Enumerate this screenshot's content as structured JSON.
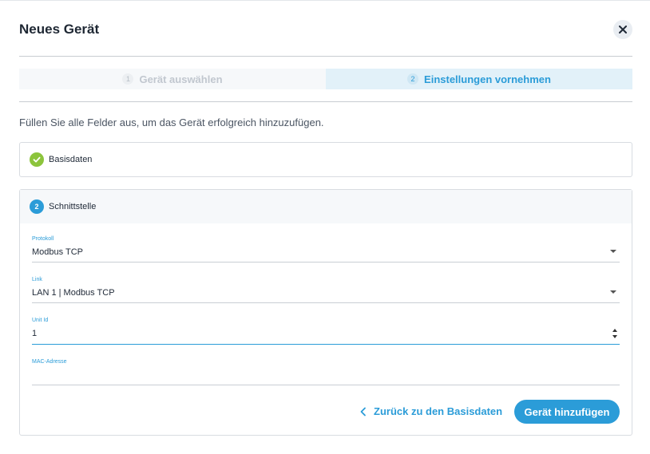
{
  "dialog": {
    "title": "Neues Gerät"
  },
  "steps": [
    {
      "number": "1",
      "label": "Gerät auswählen",
      "state": "inactive"
    },
    {
      "number": "2",
      "label": "Einstellungen vornehmen",
      "state": "active"
    }
  ],
  "intro": "Füllen Sie alle Felder aus, um das Gerät erfolgreich hinzuzufügen.",
  "panels": {
    "basisdaten": {
      "title": "Basisdaten",
      "status": "complete"
    },
    "schnittstelle": {
      "number": "2",
      "title": "Schnittstelle"
    }
  },
  "form": {
    "protokoll": {
      "label": "Protokoll",
      "value": "Modbus TCP"
    },
    "link": {
      "label": "Link",
      "value": "LAN 1 | Modbus TCP"
    },
    "unit_id": {
      "label": "Unit Id",
      "value": "1"
    },
    "mac": {
      "label": "MAC-Adresse",
      "value": ""
    }
  },
  "actions": {
    "back_label": "Zurück zu den Basisdaten",
    "submit_label": "Gerät hinzufügen"
  },
  "colors": {
    "accent": "#2b9cd8",
    "success": "#8cc43c"
  }
}
